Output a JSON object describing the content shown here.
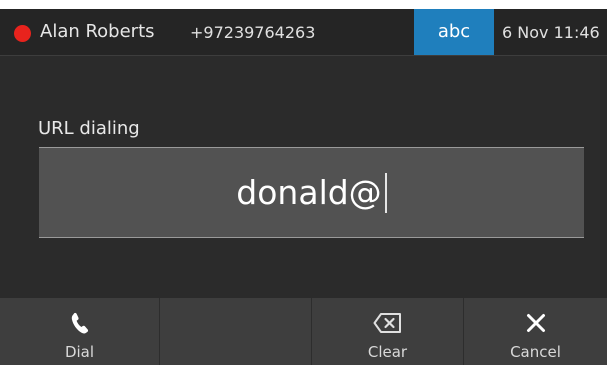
{
  "header": {
    "user_name": "Alan Roberts",
    "user_number": "+97239764263",
    "input_mode": "abc",
    "clock": "6 Nov 11:46",
    "presence_color": "#e8231d",
    "accent_color": "#1f7fbd"
  },
  "dialer": {
    "label": "URL dialing",
    "value": "donald@"
  },
  "softkeys": [
    {
      "label": "Dial",
      "icon": "phone-handset-icon"
    },
    {
      "label": "",
      "icon": ""
    },
    {
      "label": "Clear",
      "icon": "backspace-icon"
    },
    {
      "label": "Cancel",
      "icon": "close-icon"
    }
  ]
}
